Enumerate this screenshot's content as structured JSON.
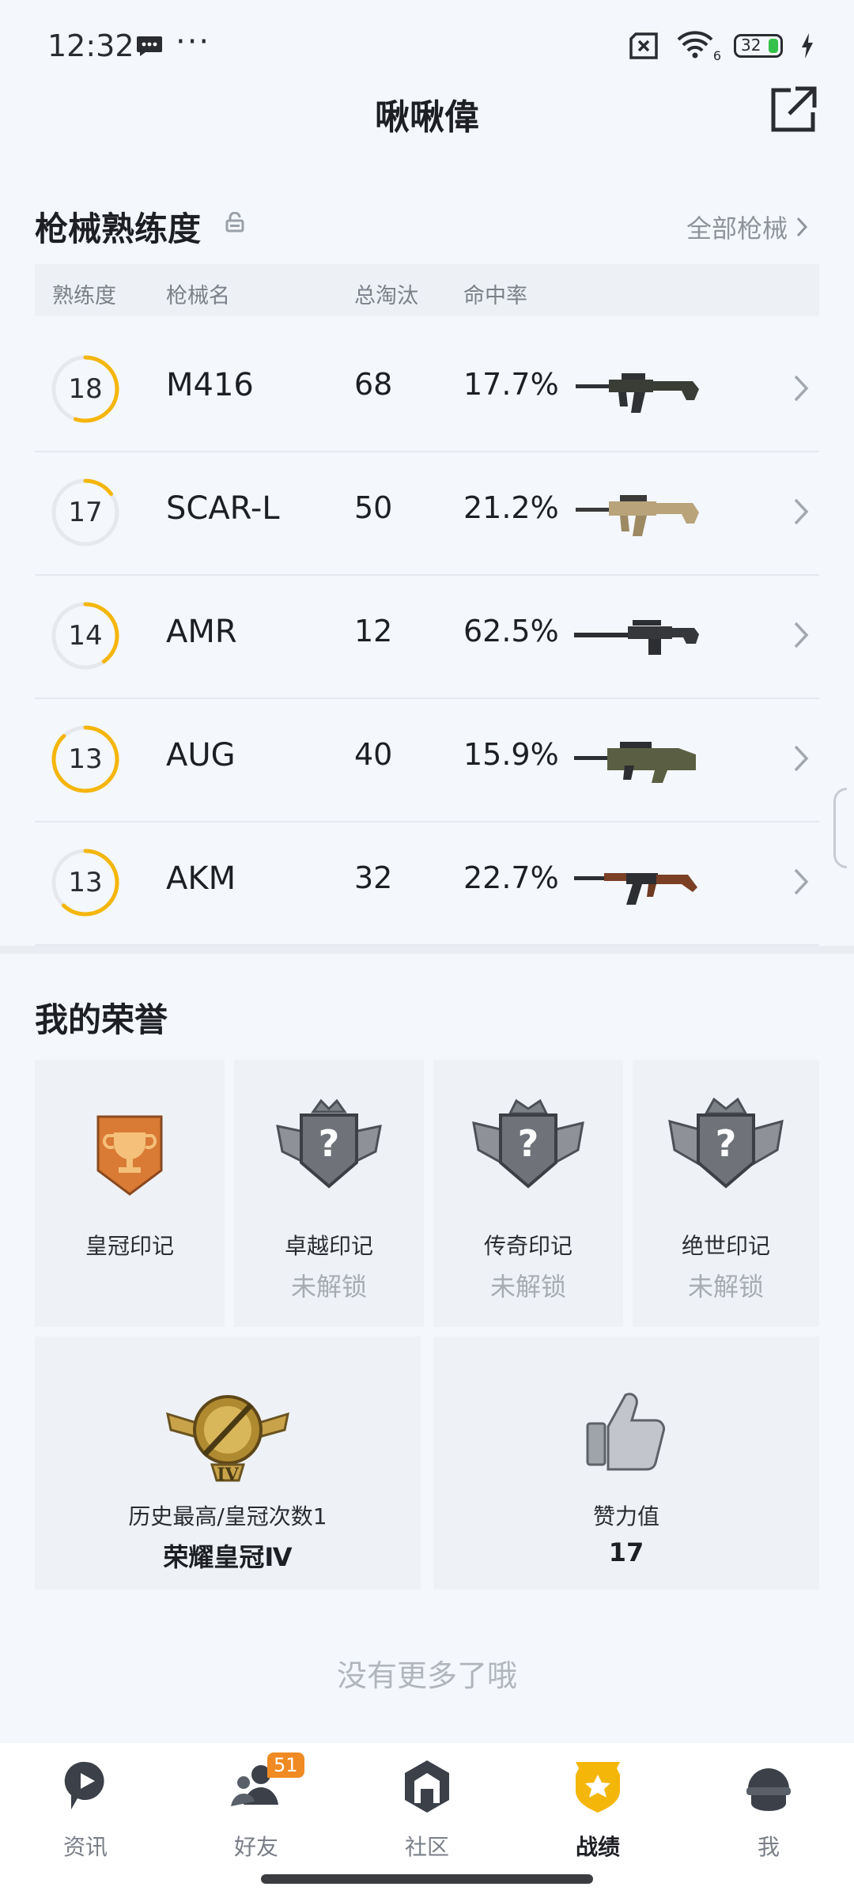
{
  "status_bar": {
    "time": "12:32",
    "dots": "···",
    "wifi_sub": "6",
    "battery_pct": "32"
  },
  "header": {
    "title": "啾啾偉"
  },
  "weapons": {
    "section_title": "枪械熟练度",
    "all_link": "全部枪械",
    "columns": [
      "熟练度",
      "枪械名",
      "总淘汰",
      "命中率"
    ],
    "rows": [
      {
        "level": "18",
        "progress": 0.55,
        "name": "M416",
        "kills": "68",
        "rate": "17.7%"
      },
      {
        "level": "17",
        "progress": 0.15,
        "name": "SCAR-L",
        "kills": "50",
        "rate": "21.2%"
      },
      {
        "level": "14",
        "progress": 0.4,
        "name": "AMR",
        "kills": "12",
        "rate": "62.5%"
      },
      {
        "level": "13",
        "progress": 0.88,
        "name": "AUG",
        "kills": "40",
        "rate": "15.9%"
      },
      {
        "level": "13",
        "progress": 0.62,
        "name": "AKM",
        "kills": "32",
        "rate": "22.7%"
      }
    ]
  },
  "honors": {
    "section_title": "我的荣誉",
    "marks": [
      {
        "name": "皇冠印记",
        "status": ""
      },
      {
        "name": "卓越印记",
        "status": "未解锁"
      },
      {
        "name": "传奇印记",
        "status": "未解锁"
      },
      {
        "name": "绝世印记",
        "status": "未解锁"
      }
    ],
    "rank": {
      "label": "历史最高/皇冠次数1",
      "value": "荣耀皇冠Ⅳ",
      "emblem_numeral": "IV"
    },
    "likes": {
      "label": "赞力值",
      "value": "17"
    }
  },
  "no_more": "没有更多了哦",
  "nav": {
    "items": [
      {
        "label": "资讯",
        "icon": "news-icon"
      },
      {
        "label": "好友",
        "icon": "friends-icon",
        "badge": "51"
      },
      {
        "label": "社区",
        "icon": "community-icon"
      },
      {
        "label": "战绩",
        "icon": "record-icon",
        "active": true
      },
      {
        "label": "我",
        "icon": "me-icon"
      }
    ]
  },
  "colors": {
    "accent": "#f5b60a",
    "ring_track": "#e6e8ec",
    "badge": "#f08a23"
  }
}
